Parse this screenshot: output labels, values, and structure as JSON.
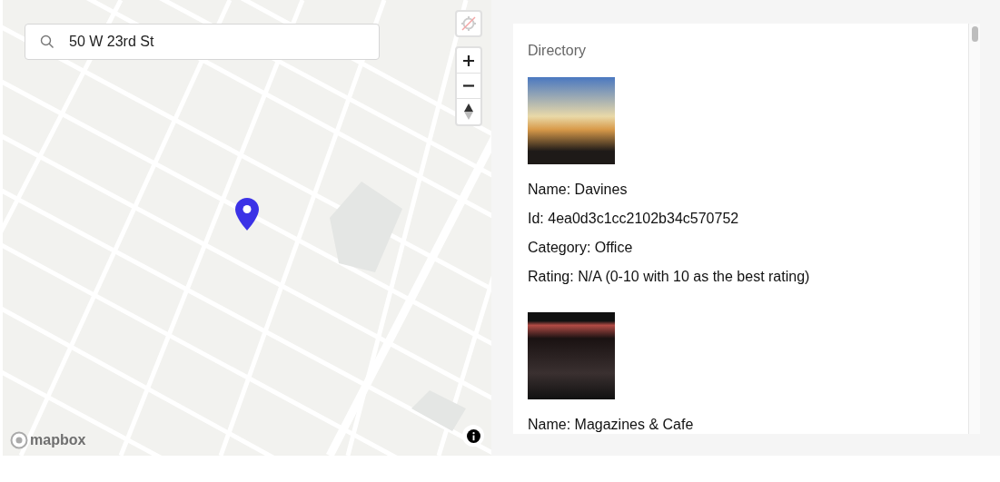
{
  "map": {
    "search": {
      "value": "50 W 23rd St"
    },
    "geolocate": {
      "disabled": true
    },
    "logo": "mapbox"
  },
  "directory": {
    "title": "Directory",
    "entries": [
      {
        "lines": [
          "Name: Davines",
          "Id: 4ea0d3c1cc2102b34c570752",
          "Category: Office",
          "Rating: N/A (0-10 with 10 as the best rating)"
        ]
      },
      {
        "lines": [
          "Name: Magazines & Cafe"
        ]
      }
    ]
  }
}
